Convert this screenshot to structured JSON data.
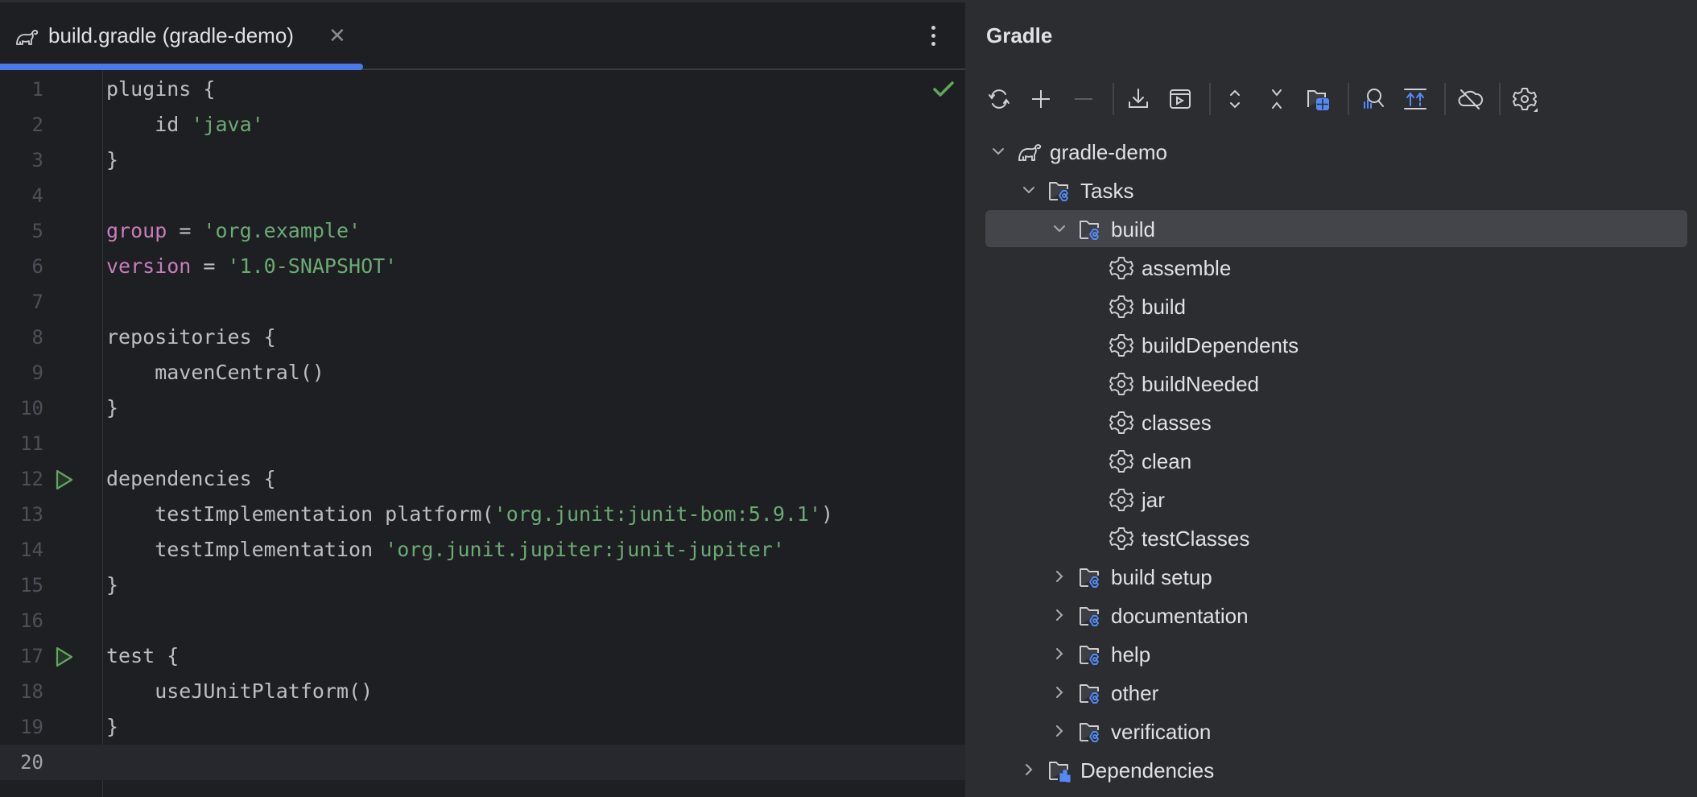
{
  "editor": {
    "tab": {
      "title": "build.gradle (gradle-demo)",
      "icon": "gradle-elephant-icon",
      "close_icon": "close-icon",
      "active": true
    },
    "more_icon": "more-vertical-icon",
    "status_icon": "check-icon",
    "current_line": 20,
    "lines": [
      {
        "n": "1",
        "run": false,
        "tokens": [
          {
            "t": "plugins {",
            "c": "plain"
          }
        ]
      },
      {
        "n": "2",
        "run": false,
        "tokens": [
          {
            "t": "    id ",
            "c": "plain"
          },
          {
            "t": "'java'",
            "c": "str"
          }
        ]
      },
      {
        "n": "3",
        "run": false,
        "tokens": [
          {
            "t": "}",
            "c": "plain"
          }
        ]
      },
      {
        "n": "4",
        "run": false,
        "tokens": []
      },
      {
        "n": "5",
        "run": false,
        "tokens": [
          {
            "t": "group",
            "c": "kw"
          },
          {
            "t": " = ",
            "c": "plain"
          },
          {
            "t": "'org.example'",
            "c": "str"
          }
        ]
      },
      {
        "n": "6",
        "run": false,
        "tokens": [
          {
            "t": "version",
            "c": "kw"
          },
          {
            "t": " = ",
            "c": "plain"
          },
          {
            "t": "'1.0-SNAPSHOT'",
            "c": "str"
          }
        ]
      },
      {
        "n": "7",
        "run": false,
        "tokens": []
      },
      {
        "n": "8",
        "run": false,
        "tokens": [
          {
            "t": "repositories {",
            "c": "plain"
          }
        ]
      },
      {
        "n": "9",
        "run": false,
        "tokens": [
          {
            "t": "    mavenCentral()",
            "c": "plain"
          }
        ]
      },
      {
        "n": "10",
        "run": false,
        "tokens": [
          {
            "t": "}",
            "c": "plain"
          }
        ]
      },
      {
        "n": "11",
        "run": false,
        "tokens": []
      },
      {
        "n": "12",
        "run": true,
        "tokens": [
          {
            "t": "dependencies {",
            "c": "plain"
          }
        ]
      },
      {
        "n": "13",
        "run": false,
        "tokens": [
          {
            "t": "    testImplementation platform(",
            "c": "plain"
          },
          {
            "t": "'org.junit:junit-bom:5.9.1'",
            "c": "str"
          },
          {
            "t": ")",
            "c": "plain"
          }
        ]
      },
      {
        "n": "14",
        "run": false,
        "tokens": [
          {
            "t": "    testImplementation ",
            "c": "plain"
          },
          {
            "t": "'org.junit.jupiter:junit-jupiter'",
            "c": "str"
          }
        ]
      },
      {
        "n": "15",
        "run": false,
        "tokens": [
          {
            "t": "}",
            "c": "plain"
          }
        ]
      },
      {
        "n": "16",
        "run": false,
        "tokens": []
      },
      {
        "n": "17",
        "run": true,
        "tokens": [
          {
            "t": "test {",
            "c": "plain"
          }
        ]
      },
      {
        "n": "18",
        "run": false,
        "tokens": [
          {
            "t": "    useJUnitPlatform()",
            "c": "plain"
          }
        ]
      },
      {
        "n": "19",
        "run": false,
        "tokens": [
          {
            "t": "}",
            "c": "plain"
          }
        ]
      },
      {
        "n": "20",
        "run": false,
        "tokens": []
      }
    ]
  },
  "gradle_panel": {
    "title": "Gradle",
    "toolbar": [
      {
        "name": "reload-all-gradle-projects",
        "icon": "sync-icon"
      },
      {
        "name": "link-gradle-project",
        "icon": "plus-icon"
      },
      {
        "name": "unlink-gradle-project",
        "icon": "minus-icon",
        "disabled": true
      },
      {
        "sep": true
      },
      {
        "name": "download-sources",
        "icon": "download-icon"
      },
      {
        "name": "execute-gradle-task",
        "icon": "run-window-icon"
      },
      {
        "sep": true
      },
      {
        "name": "expand-all",
        "icon": "expand-all-icon"
      },
      {
        "name": "collapse-all",
        "icon": "collapse-all-icon"
      },
      {
        "name": "group-modules",
        "icon": "folder-grid-icon"
      },
      {
        "sep": true
      },
      {
        "name": "analyze-dependencies",
        "icon": "analyze-icon"
      },
      {
        "name": "show-dependencies-upward",
        "icon": "align-top-arrows-icon"
      },
      {
        "sep": true
      },
      {
        "name": "toggle-offline-mode",
        "icon": "cloud-off-icon"
      },
      {
        "sep": true
      },
      {
        "name": "build-tool-settings",
        "icon": "settings-icon"
      }
    ],
    "tree": [
      {
        "label": "gradle-demo",
        "level": 0,
        "chevron": "down",
        "icon": "gradle-elephant-icon"
      },
      {
        "label": "Tasks",
        "level": 1,
        "chevron": "down",
        "icon": "task-folder-icon"
      },
      {
        "label": "build",
        "level": 2,
        "chevron": "down",
        "icon": "task-folder-icon",
        "selected": true
      },
      {
        "label": "assemble",
        "level": 3,
        "chevron": "none",
        "icon": "gear-icon"
      },
      {
        "label": "build",
        "level": 3,
        "chevron": "none",
        "icon": "gear-icon"
      },
      {
        "label": "buildDependents",
        "level": 3,
        "chevron": "none",
        "icon": "gear-icon"
      },
      {
        "label": "buildNeeded",
        "level": 3,
        "chevron": "none",
        "icon": "gear-icon"
      },
      {
        "label": "classes",
        "level": 3,
        "chevron": "none",
        "icon": "gear-icon"
      },
      {
        "label": "clean",
        "level": 3,
        "chevron": "none",
        "icon": "gear-icon"
      },
      {
        "label": "jar",
        "level": 3,
        "chevron": "none",
        "icon": "gear-icon"
      },
      {
        "label": "testClasses",
        "level": 3,
        "chevron": "none",
        "icon": "gear-icon"
      },
      {
        "label": "build setup",
        "level": 2,
        "chevron": "right",
        "icon": "task-folder-icon"
      },
      {
        "label": "documentation",
        "level": 2,
        "chevron": "right",
        "icon": "task-folder-icon"
      },
      {
        "label": "help",
        "level": 2,
        "chevron": "right",
        "icon": "task-folder-icon"
      },
      {
        "label": "other",
        "level": 2,
        "chevron": "right",
        "icon": "task-folder-icon"
      },
      {
        "label": "verification",
        "level": 2,
        "chevron": "right",
        "icon": "task-folder-icon"
      },
      {
        "label": "Dependencies",
        "level": 1,
        "chevron": "right",
        "icon": "dependencies-folder-icon"
      }
    ]
  },
  "colors": {
    "accent": "#4a7ae6",
    "string": "#6aab73",
    "keyword": "#c77dbb",
    "text": "#bcbec4",
    "run_green": "#5fa75a",
    "icon_blue": "#548af7"
  }
}
